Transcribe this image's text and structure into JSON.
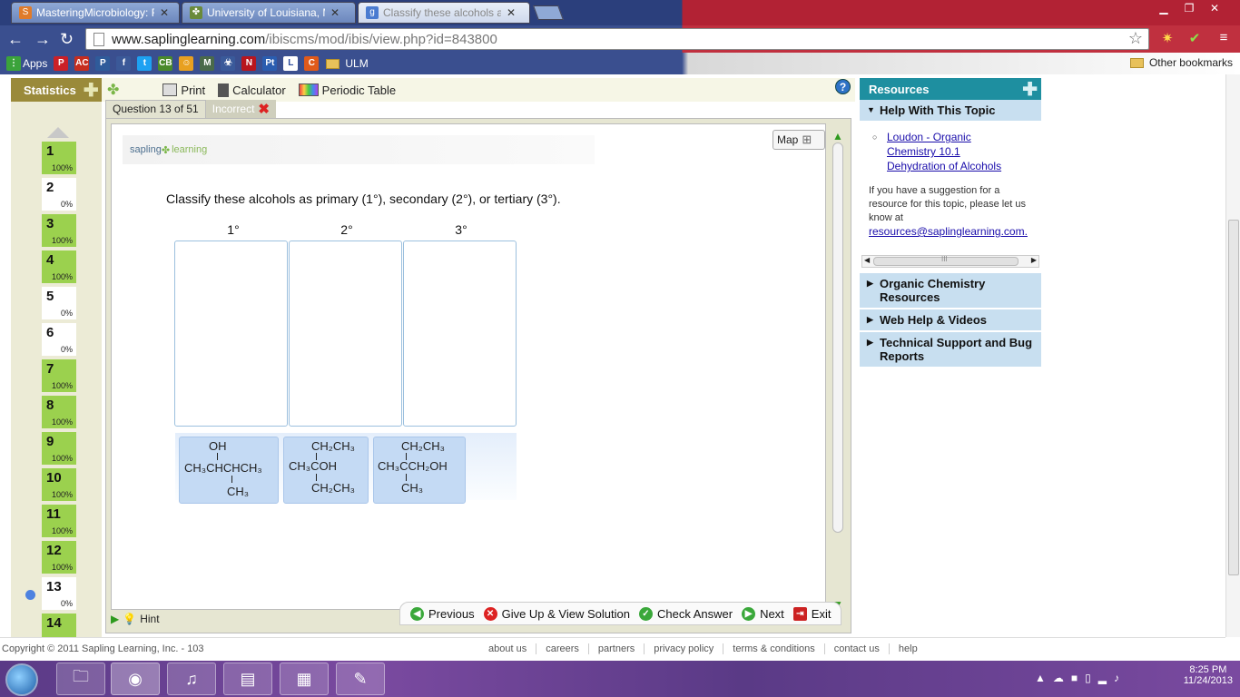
{
  "browser": {
    "tabs": [
      {
        "title": "MasteringMicrobiology: R",
        "icon": "mastering-icon"
      },
      {
        "title": "University of Louisiana, M",
        "icon": "ulm-icon"
      },
      {
        "title": "Classify these alcohols as",
        "icon": "sapling-icon"
      }
    ],
    "url_host": "www.saplinglearning.com",
    "url_path": "/ibiscms/mod/ibis/view.php?id=843800",
    "bookmarks": {
      "apps_label": "Apps",
      "ulm_label": "ULM",
      "other_label": "Other bookmarks",
      "icons": [
        "P",
        "AC",
        "P",
        "f",
        "t",
        "CB",
        "☺",
        "M",
        "☣",
        "N",
        "Pt",
        "L",
        "C"
      ]
    }
  },
  "toolbar": {
    "statistics_label": "Statistics",
    "print_label": "Print",
    "calculator_label": "Calculator",
    "periodic_label": "Periodic Table",
    "help_label": "?"
  },
  "questions": [
    {
      "n": "1",
      "p": "100%",
      "done": true
    },
    {
      "n": "2",
      "p": "0%",
      "done": false
    },
    {
      "n": "3",
      "p": "100%",
      "done": true
    },
    {
      "n": "4",
      "p": "100%",
      "done": true
    },
    {
      "n": "5",
      "p": "0%",
      "done": false
    },
    {
      "n": "6",
      "p": "0%",
      "done": false
    },
    {
      "n": "7",
      "p": "100%",
      "done": true
    },
    {
      "n": "8",
      "p": "100%",
      "done": true
    },
    {
      "n": "9",
      "p": "100%",
      "done": true
    },
    {
      "n": "10",
      "p": "100%",
      "done": true
    },
    {
      "n": "11",
      "p": "100%",
      "done": true
    },
    {
      "n": "12",
      "p": "100%",
      "done": true
    },
    {
      "n": "13",
      "p": "0%",
      "done": false
    },
    {
      "n": "14",
      "p": "",
      "done": true
    }
  ],
  "question": {
    "tab_label": "Question 13 of 51",
    "status_label": "Incorrect",
    "logo_sapling": "sapling",
    "logo_learning": "learning",
    "map_label": "Map",
    "prompt": "Classify these alcohols as primary (1°), secondary (2°), or tertiary (3°).",
    "columns": [
      "1°",
      "2°",
      "3°"
    ],
    "molecules": [
      {
        "top": "OH",
        "middle": "CH₃CHCHCH₃",
        "bottom": "CH₃"
      },
      {
        "top": "CH₂CH₃",
        "middle": "CH₃COH",
        "bottom": "CH₂CH₃"
      },
      {
        "top": "CH₂CH₃",
        "middle": "CH₃CCH₂OH",
        "bottom": "CH₃"
      }
    ],
    "hint_label": "Hint",
    "previous_label": "Previous",
    "giveup_label": "Give Up & View Solution",
    "check_label": "Check Answer",
    "next_label": "Next",
    "exit_label": "Exit"
  },
  "resources": {
    "title": "Resources",
    "help_topic": "Help With This Topic",
    "link_lines": [
      "Loudon - Organic",
      "Chemistry 10.1",
      "Dehydration of Alcohols"
    ],
    "suggestion": "If you have a suggestion for a resource for this topic, please let us know at",
    "email": "resources@saplinglearning.com.",
    "sections": [
      "Organic Chemistry Resources",
      "Web Help & Videos",
      "Technical Support and Bug Reports"
    ],
    "scroll_mark": "III"
  },
  "footer": {
    "copyright": "Copyright © 2011 Sapling Learning, Inc. - 103",
    "links": [
      "about us",
      "careers",
      "partners",
      "privacy policy",
      "terms & conditions",
      "contact us",
      "help"
    ]
  },
  "taskbar": {
    "time": "8:25 PM",
    "date": "11/24/2013"
  },
  "colors": {
    "complete": "#9bd14e",
    "resources_header": "#1e8fa0",
    "accordion": "#c8dff0",
    "molecule_tile": "#c4daf4"
  }
}
